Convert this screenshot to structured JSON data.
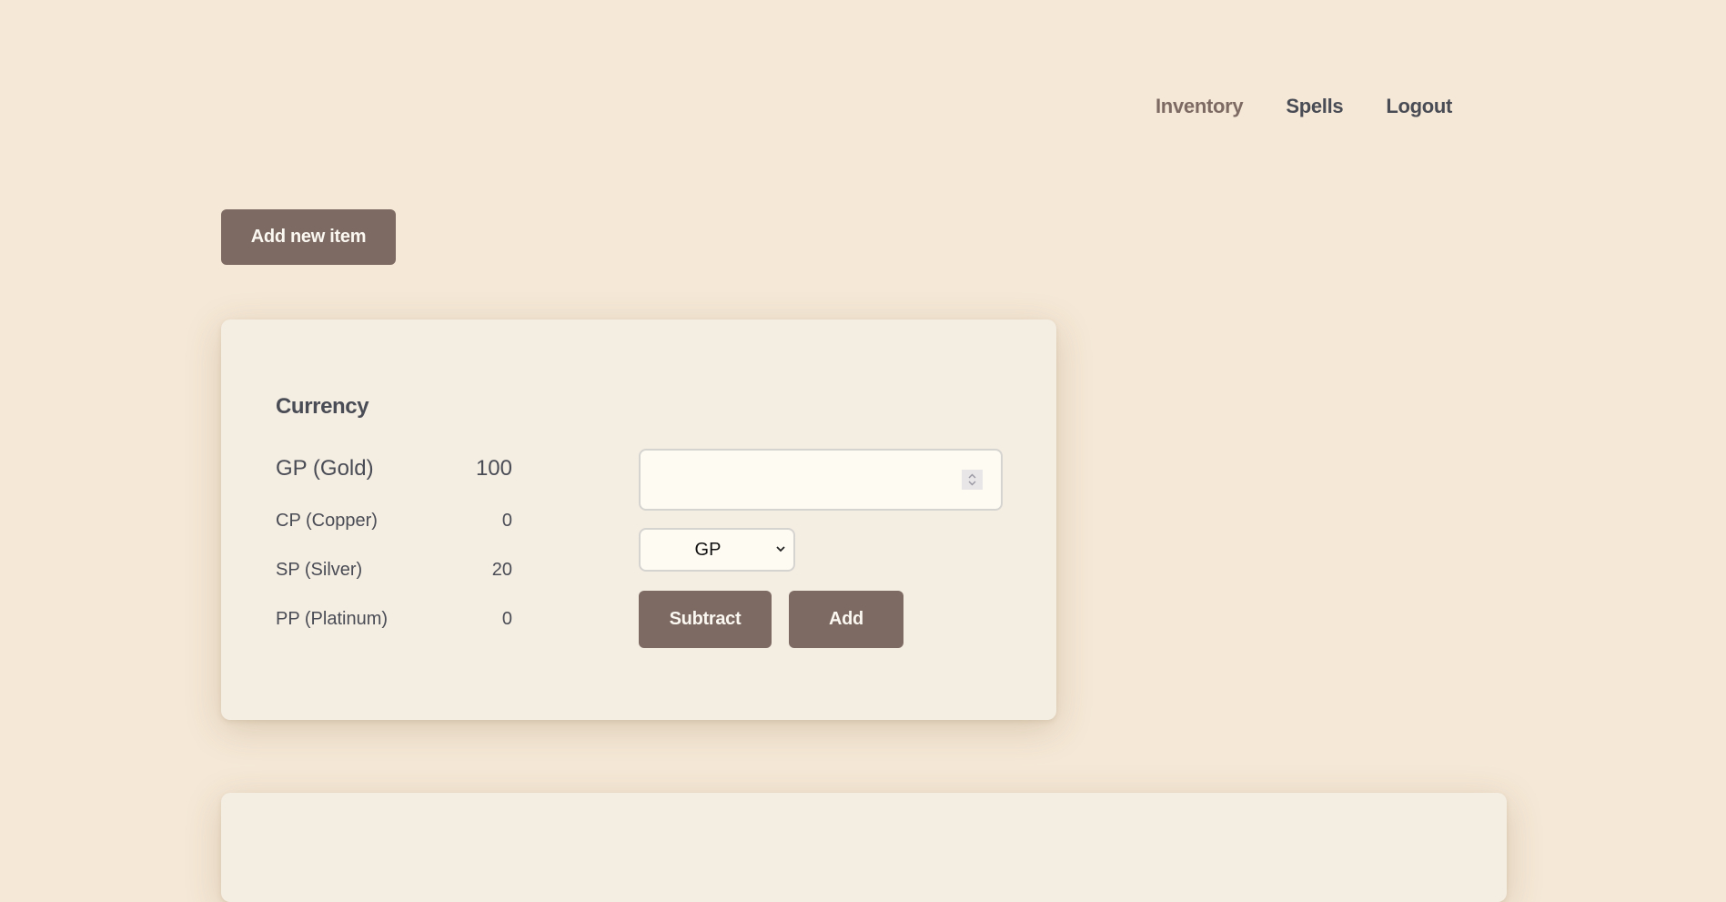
{
  "nav": {
    "items": [
      {
        "label": "Inventory",
        "active": true
      },
      {
        "label": "Spells",
        "active": false
      },
      {
        "label": "Logout",
        "active": false
      }
    ]
  },
  "toolbar": {
    "add_new_item_label": "Add new item"
  },
  "currency": {
    "title": "Currency",
    "coins": [
      {
        "label": "GP (Gold)",
        "value": "100"
      },
      {
        "label": "CP (Copper)",
        "value": "0"
      },
      {
        "label": "SP (Silver)",
        "value": "20"
      },
      {
        "label": "PP (Platinum)",
        "value": "0"
      }
    ],
    "amount_input": {
      "value": "",
      "placeholder": ""
    },
    "currency_select": {
      "selected": "GP"
    },
    "subtract_label": "Subtract",
    "add_label": "Add"
  },
  "colors": {
    "background": "#f5e8d6",
    "card": "#f4ede2",
    "accent": "#7d6a63",
    "text": "#4a4c55",
    "input_bg": "#fefbf3"
  }
}
